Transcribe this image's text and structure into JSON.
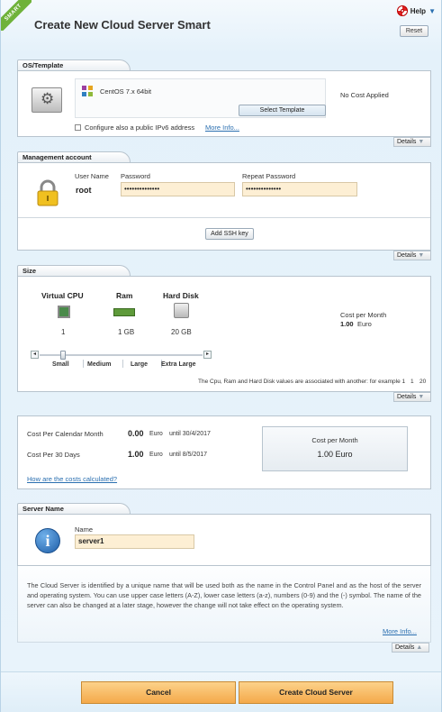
{
  "header": {
    "ribbon": "SMART",
    "title": "Create New Cloud Server Smart",
    "help_label": "Help",
    "reset_label": "Reset"
  },
  "os_template": {
    "tab": "OS/Template",
    "selected_os": "CentOS 7.x 64bit",
    "select_button": "Select Template",
    "cost_note": "No Cost Applied",
    "ipv6_label": "Configure also a public IPv6 address",
    "ipv6_checked": false,
    "more_info": "More Info...",
    "details": "Details"
  },
  "management": {
    "tab": "Management account",
    "username_label": "User Name",
    "username": "root",
    "password_label": "Password",
    "password_value": "••••••••••••••",
    "repeat_label": "Repeat Password",
    "repeat_value": "••••••••••••••",
    "ssh_button": "Add SSH key",
    "details": "Details"
  },
  "size": {
    "tab": "Size",
    "cpu_label": "Virtual CPU",
    "ram_label": "Ram",
    "disk_label": "Hard Disk",
    "cpu_value": "1",
    "ram_value": "1 GB",
    "disk_value": "20 GB",
    "cost_label": "Cost per Month",
    "cost_value": "1.00",
    "cost_unit": "Euro",
    "slider_level": 0,
    "steps": [
      "Small",
      "Medium",
      "Large",
      "Extra Large"
    ],
    "note": "The Cpu, Ram and Hard Disk values are associated with another: for example 1",
    "note_nums": [
      "1",
      "20"
    ],
    "details": "Details"
  },
  "costs": {
    "row1_label": "Cost Per Calendar Month",
    "row1_value": "0.00",
    "row1_unit": "Euro",
    "row1_until": "until 30/4/2017",
    "row2_label": "Cost Per 30 Days",
    "row2_value": "1.00",
    "row2_unit": "Euro",
    "row2_until": "until 8/5/2017",
    "box_label": "Cost per Month",
    "box_value": "1.00 Euro",
    "how_link": "How are the costs calculated?"
  },
  "server_name": {
    "tab": "Server Name",
    "name_label": "Name",
    "name_value": "server1",
    "description": "The Cloud Server is identified by a unique name that will be used both as the name in the Control Panel and as the host of the server and operating system. You can use upper case letters (A-Z), lower case letters (a-z), numbers (0-9) and the (-) symbol. The name of the server can also be changed at a later stage, however the change will not take effect on the operating system.",
    "more_info": "More Info...",
    "details": "Details"
  },
  "footer": {
    "cancel": "Cancel",
    "create": "Create Cloud Server"
  },
  "colors": {
    "accent_orange": "#f4a94a",
    "input_bg": "#fdefd4",
    "link": "#2a6fb0",
    "ribbon_green": "#6fb23a"
  }
}
